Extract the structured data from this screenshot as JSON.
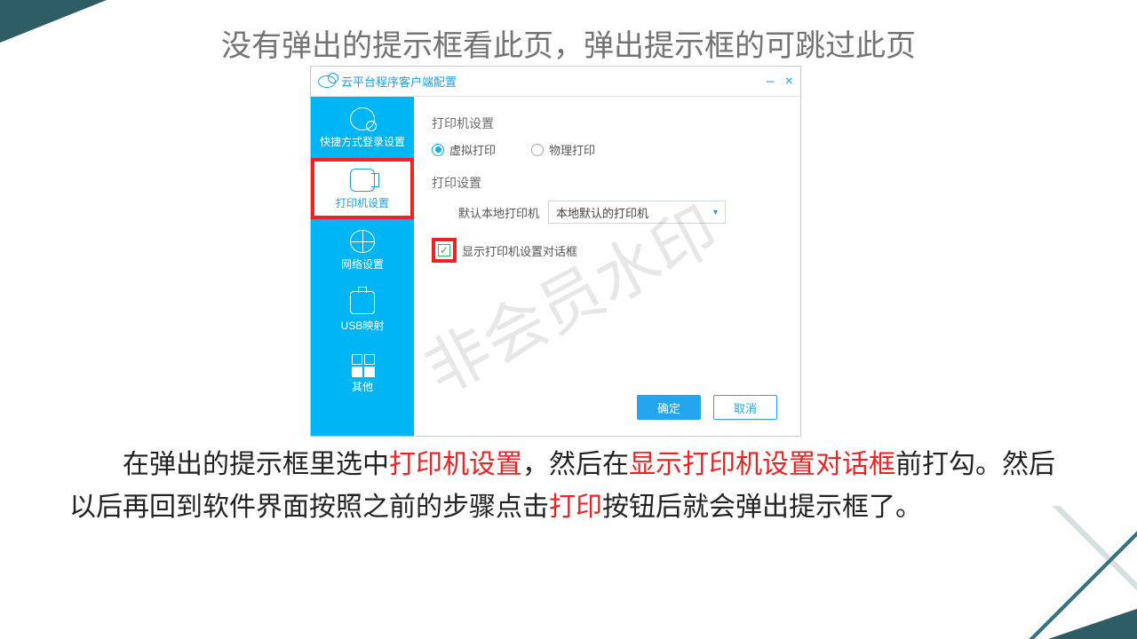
{
  "title": "没有弹出的提示框看此页，弹出提示框的可跳过此页",
  "watermark": "非会员水印",
  "dialog": {
    "title": "云平台程序客户端配置",
    "sidebar": {
      "items": [
        {
          "label": "快捷方式登录设置"
        },
        {
          "label": "打印机设置"
        },
        {
          "label": "网络设置"
        },
        {
          "label": "USB映射"
        },
        {
          "label": "其他"
        }
      ]
    },
    "panel": {
      "section1_title": "打印机设置",
      "radio_virtual": "虚拟打印",
      "radio_physical": "物理打印",
      "section2_title": "打印设置",
      "default_printer_label": "默认本地打印机",
      "default_printer_value": "本地默认的打印机",
      "checkbox_label": "显示打印机设置对话框",
      "ok": "确定",
      "cancel": "取消"
    }
  },
  "body": {
    "t1": "在弹出的提示框里选中",
    "e1": "打印机设置",
    "t2": "，然后在",
    "e2": "显示打印机设置对话框",
    "t3": "前打勾。然后以后再回到软件界面按照之前的步骤点击",
    "e3": "打印",
    "t4": "按钮后就会弹出提示框了。"
  }
}
